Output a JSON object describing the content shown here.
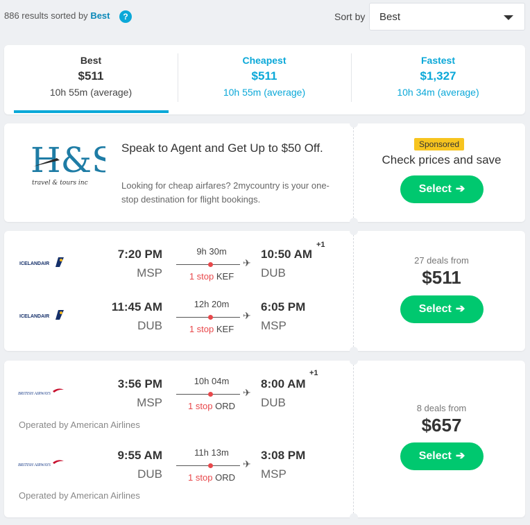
{
  "header": {
    "results_prefix": "886 results sorted by",
    "results_sort": "Best",
    "help_icon": "?",
    "sort_label": "Sort by",
    "sort_value": "Best"
  },
  "tabs": [
    {
      "label": "Best",
      "price": "$511",
      "duration": "10h 55m (average)",
      "active": true
    },
    {
      "label": "Cheapest",
      "price": "$511",
      "duration": "10h 55m (average)",
      "active": false
    },
    {
      "label": "Fastest",
      "price": "$1,327",
      "duration": "10h 34m (average)",
      "active": false
    }
  ],
  "ad": {
    "logo_text": "H&S",
    "logo_subtext": "travel & tours inc",
    "title": "Speak to Agent and Get Up to $50 Off.",
    "description": "Looking for cheap airfares? 2mycountry is your one-stop destination for flight bookings.",
    "badge": "Sponsored",
    "cta": "Check prices and save",
    "button": "Select"
  },
  "results": [
    {
      "legs": [
        {
          "airline_logo": "ICELANDAIR",
          "depart_time": "7:20 PM",
          "depart_airport": "MSP",
          "duration": "9h 30m",
          "stops": "1 stop",
          "via": "KEF",
          "arrive_time": "10:50 AM",
          "plus_days": "+1",
          "arrive_airport": "DUB"
        },
        {
          "airline_logo": "ICELANDAIR",
          "depart_time": "11:45 AM",
          "depart_airport": "DUB",
          "duration": "12h 20m",
          "stops": "1 stop",
          "via": "KEF",
          "arrive_time": "6:05 PM",
          "plus_days": "",
          "arrive_airport": "MSP"
        }
      ],
      "deals": "27 deals from",
      "price": "$511",
      "button": "Select"
    },
    {
      "legs": [
        {
          "airline_logo": "BRITISH AIRWAYS",
          "depart_time": "3:56 PM",
          "depart_airport": "MSP",
          "duration": "10h 04m",
          "stops": "1 stop",
          "via": "ORD",
          "arrive_time": "8:00 AM",
          "plus_days": "+1",
          "arrive_airport": "DUB",
          "operated": "Operated by American Airlines"
        },
        {
          "airline_logo": "BRITISH AIRWAYS",
          "depart_time": "9:55 AM",
          "depart_airport": "DUB",
          "duration": "11h 13m",
          "stops": "1 stop",
          "via": "ORD",
          "arrive_time": "3:08 PM",
          "plus_days": "",
          "arrive_airport": "MSP",
          "operated": "Operated by American Airlines"
        }
      ],
      "deals": "8 deals from",
      "price": "$657",
      "button": "Select"
    }
  ],
  "colors": {
    "accent": "#0ba8d8",
    "button": "#00c86f",
    "stop_red": "#e8484b",
    "badge": "#f7c41f"
  },
  "icons": {
    "arrow": "arrow-right-icon",
    "plane": "plane-icon",
    "help": "help-icon",
    "caret": "chevron-down-icon"
  }
}
